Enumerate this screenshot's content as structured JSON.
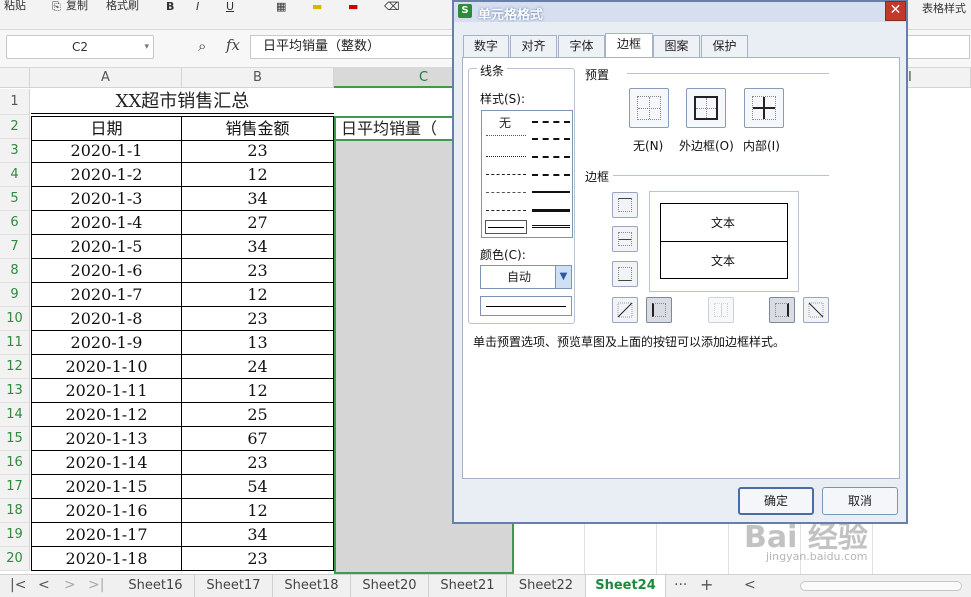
{
  "toolbar": {
    "paste": "粘贴",
    "copy": "复制",
    "format_painter": "格式刷",
    "table_style": "表格样式"
  },
  "formula_bar": {
    "name_box": "C2",
    "fx": "fx",
    "formula": "日平均销量（整数）"
  },
  "sheet": {
    "columns": [
      "A",
      "B",
      "C",
      "I"
    ],
    "rows": [
      "1",
      "2",
      "3",
      "4",
      "5",
      "6",
      "7",
      "8",
      "9",
      "10",
      "11",
      "12",
      "13",
      "14",
      "15",
      "16",
      "17",
      "18",
      "19",
      "20"
    ],
    "title": "XX超市销售汇总",
    "headers": {
      "date": "日期",
      "amount": "销售金额",
      "avg": "日平均销量（"
    },
    "data": [
      {
        "date": "2020-1-1",
        "amount": "23"
      },
      {
        "date": "2020-1-2",
        "amount": "12"
      },
      {
        "date": "2020-1-3",
        "amount": "34"
      },
      {
        "date": "2020-1-4",
        "amount": "27"
      },
      {
        "date": "2020-1-5",
        "amount": "34"
      },
      {
        "date": "2020-1-6",
        "amount": "23"
      },
      {
        "date": "2020-1-7",
        "amount": "12"
      },
      {
        "date": "2020-1-8",
        "amount": "23"
      },
      {
        "date": "2020-1-9",
        "amount": "13"
      },
      {
        "date": "2020-1-10",
        "amount": "24"
      },
      {
        "date": "2020-1-11",
        "amount": "12"
      },
      {
        "date": "2020-1-12",
        "amount": "25"
      },
      {
        "date": "2020-1-13",
        "amount": "67"
      },
      {
        "date": "2020-1-14",
        "amount": "23"
      },
      {
        "date": "2020-1-15",
        "amount": "54"
      },
      {
        "date": "2020-1-16",
        "amount": "12"
      },
      {
        "date": "2020-1-17",
        "amount": "34"
      },
      {
        "date": "2020-1-18",
        "amount": "23"
      }
    ]
  },
  "sheet_tabs": {
    "tabs": [
      "Sheet16",
      "Sheet17",
      "Sheet18",
      "Sheet20",
      "Sheet21",
      "Sheet22",
      "Sheet24"
    ],
    "active": "Sheet24",
    "more": "···",
    "add": "+"
  },
  "dialog": {
    "logo": "S",
    "title": "单元格格式",
    "close": "✕",
    "tabs": [
      "数字",
      "对齐",
      "字体",
      "边框",
      "图案",
      "保护"
    ],
    "active_tab": "边框",
    "line_group": "线条",
    "style_label": "样式(S):",
    "style_none": "无",
    "color_label": "颜色(C):",
    "color_value": "自动",
    "preset_group": "预置",
    "preset_none": "无(N)",
    "preset_outline": "外边框(O)",
    "preset_inside": "内部(I)",
    "border_group": "边框",
    "preview_text_top": "文本",
    "preview_text_bottom": "文本",
    "hint": "单击预置选项、预览草图及上面的按钮可以添加边框样式。",
    "ok": "确定",
    "cancel": "取消"
  },
  "watermark": {
    "brand": "Bai 经验",
    "url": "jingyan.baidu.com"
  },
  "colors": {
    "selection_border": "#3f9b4c",
    "active_tab_text": "#1f8a3a",
    "dialog_frame": "#6a7fa8"
  }
}
